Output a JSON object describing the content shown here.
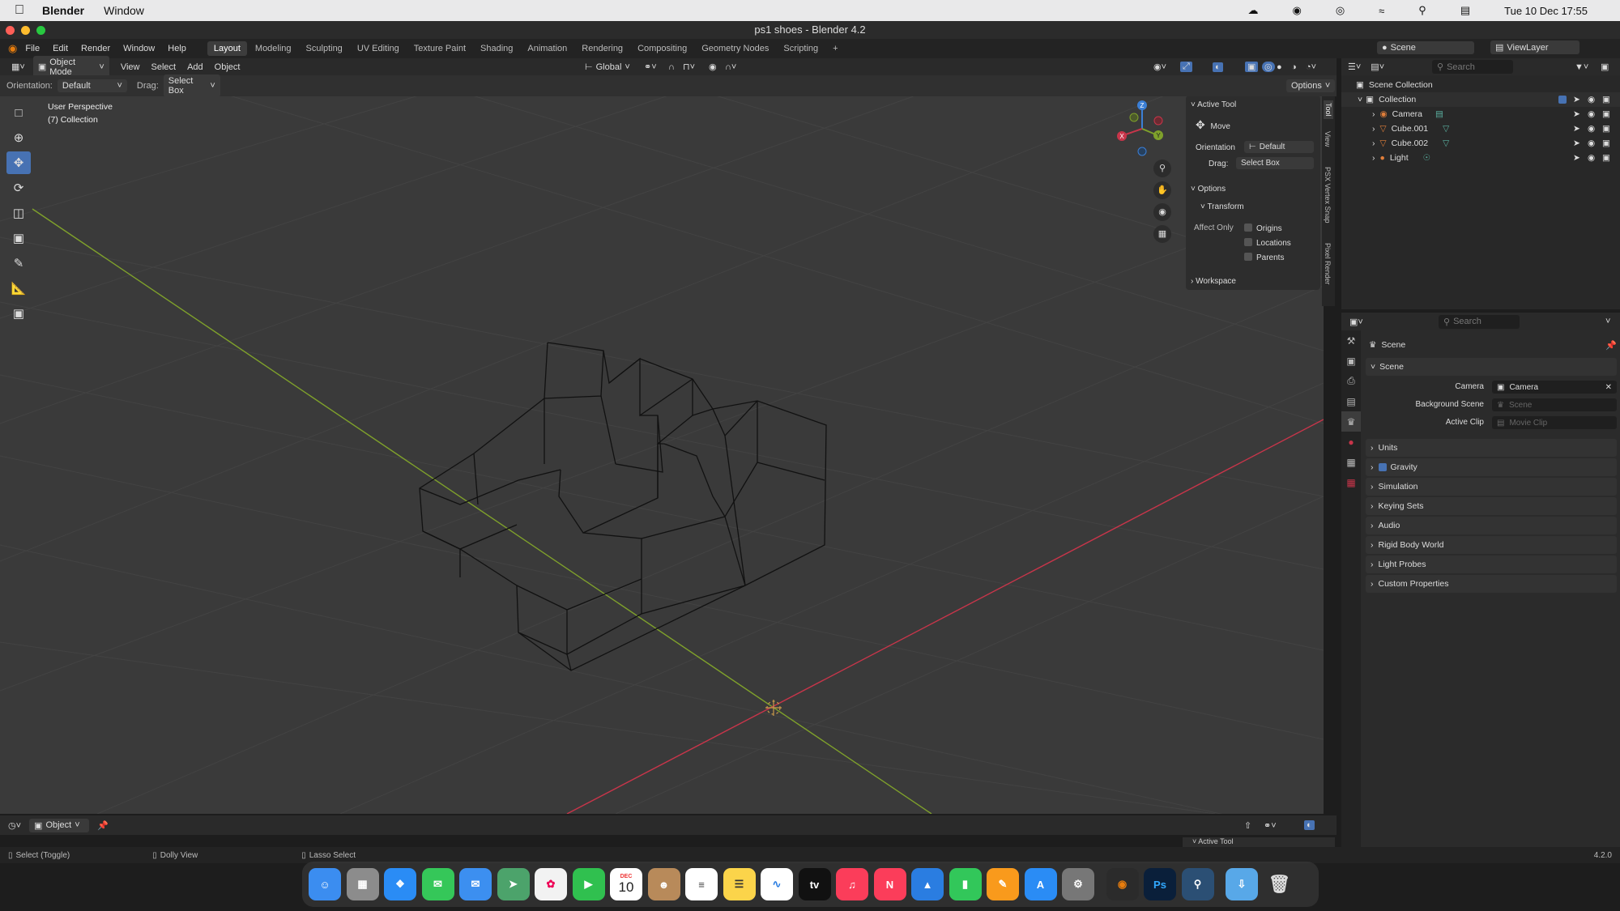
{
  "macos_menu": {
    "app": "Blender",
    "items": [
      "Window"
    ],
    "datetime": "Tue 10 Dec  17:55"
  },
  "window_title": "ps1 shoes - Blender 4.2",
  "main_menu": [
    "File",
    "Edit",
    "Render",
    "Window",
    "Help"
  ],
  "workspaces": [
    "Layout",
    "Modeling",
    "Sculpting",
    "UV Editing",
    "Texture Paint",
    "Shading",
    "Animation",
    "Rendering",
    "Compositing",
    "Geometry Nodes",
    "Scripting"
  ],
  "active_workspace": "Layout",
  "scene_selector": "Scene",
  "viewlayer_selector": "ViewLayer",
  "viewport_header": {
    "mode": "Object Mode",
    "menus": [
      "View",
      "Select",
      "Add",
      "Object"
    ],
    "transform_orientation": "Global",
    "options_label": "Options"
  },
  "tool_settings": {
    "orientation_label": "Orientation:",
    "orientation_value": "Default",
    "drag_label": "Drag:",
    "drag_value": "Select Box"
  },
  "viewport_overlay": {
    "perspective": "User Perspective",
    "collection": "(7) Collection"
  },
  "npanel": {
    "active_tool_header": "Active Tool",
    "tool_name": "Move",
    "orientation_label": "Orientation",
    "orientation_value": "Default",
    "drag_label": "Drag:",
    "drag_value": "Select Box",
    "options_header": "Options",
    "transform_header": "Transform",
    "affect_only_label": "Affect Only",
    "affect_only": [
      "Origins",
      "Locations",
      "Parents"
    ],
    "workspace_header": "Workspace",
    "tabs": [
      "Tool",
      "View",
      "PSX Vertex Snap",
      "Pixel Render"
    ]
  },
  "gizmo_axes": {
    "x": "X",
    "y": "Y",
    "z": "Z"
  },
  "outliner": {
    "search_placeholder": "Search",
    "scene_collection": "Scene Collection",
    "collection": "Collection",
    "objects": [
      "Camera",
      "Cube.001",
      "Cube.002",
      "Light"
    ]
  },
  "properties": {
    "search_placeholder": "Search",
    "context": "Scene",
    "panel": "Scene",
    "camera_label": "Camera",
    "camera_value": "Camera",
    "background_scene_label": "Background Scene",
    "background_scene_placeholder": "Scene",
    "active_clip_label": "Active Clip",
    "active_clip_placeholder": "Movie Clip",
    "sections": [
      "Units",
      "Gravity",
      "Simulation",
      "Keying Sets",
      "Audio",
      "Rigid Body World",
      "Light Probes",
      "Custom Properties"
    ]
  },
  "timeline_header": {
    "mode": "Object"
  },
  "timeline_active_tool": "Active Tool",
  "statusbar": {
    "select": "Select (Toggle)",
    "dolly": "Dolly View",
    "lasso": "Lasso Select",
    "version": "4.2.0"
  },
  "dock": {
    "calendar_month": "DEC",
    "calendar_day": "10"
  },
  "colors": {
    "accent": "#4772b3",
    "x_axis": "#c8354a",
    "y_axis": "#7fa12b",
    "z_axis": "#3b7fd6",
    "viewport_bg": "#3a3a3a"
  }
}
